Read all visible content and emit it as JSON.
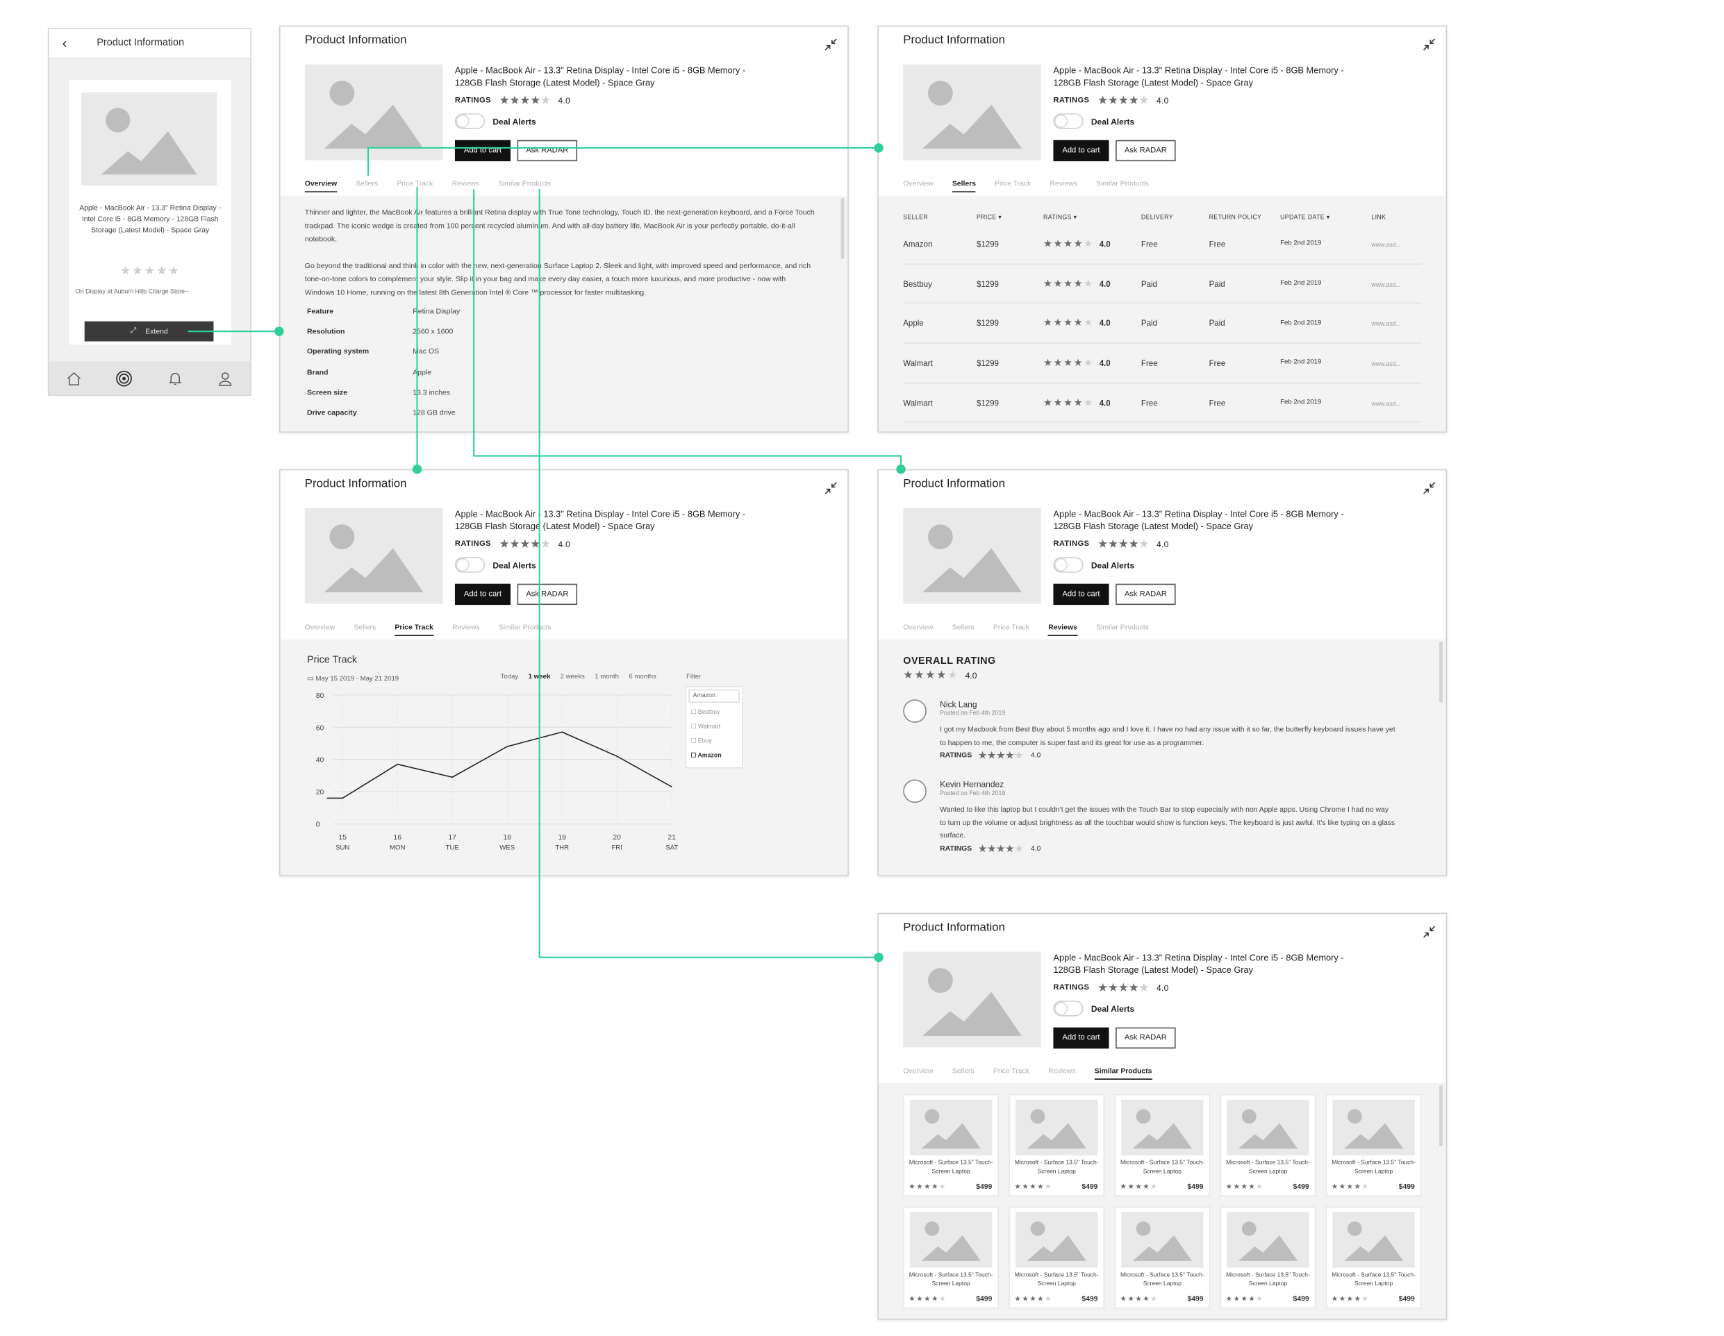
{
  "colors": {
    "connector": "#2fcf9c",
    "accent_black": "#111111",
    "placeholder_gray": "#e9e9e9",
    "content_bg": "#f3f3f3"
  },
  "icons": {
    "collapse": "collapse-arrows-icon",
    "back": "chevron-left-icon",
    "extend": "expand-arrows-icon",
    "home": "home-icon",
    "radar": "radar-icon",
    "bell": "bell-icon",
    "user": "user-icon",
    "image": "image-placeholder-icon",
    "star": "star-icon",
    "calendar": "calendar-icon",
    "checkbox": "checkbox-icon"
  },
  "product": {
    "page_title": "Product Information",
    "name": "Apple - MacBook Air - 13.3\" Retina Display - Intel Core i5 - 8GB Memory - 128GB Flash Storage (Latest Model) - Space Gray",
    "ratings_label": "RATINGS",
    "rating": "4.0",
    "rating_stars": 4,
    "deal_alerts": "Deal Alerts",
    "deal_alerts_on": false,
    "add_to_cart": "Add to cart",
    "ask_radar": "Ask RADAR"
  },
  "tabs": [
    "Overview",
    "Sellers",
    "Price Track",
    "Reviews",
    "Similar Products"
  ],
  "mobile": {
    "title": "Product Information",
    "product_name": "Apple - MacBook Air - 13.3\" Retina Display - Intel Core i5 - 8GB Memory - 128GB Flash Storage (Latest Model) - Space Gray",
    "rating_stars": 4,
    "display_note": "On Display at Auburn Hills Charge Store--",
    "extend": "Extend"
  },
  "overview": {
    "paragraph1": "Thinner and lighter, the MacBook Air features a brilliant Retina display with True Tone technology, Touch ID, the next-generation keyboard, and a Force Touch trackpad. The iconic wedge is created from 100 percent recycled aluminum. And with all-day battery life, MacBook Air is your perfectly portable, do-it-all notebook.",
    "paragraph2": "Go beyond the traditional and think in color with the new, next-generation Surface Laptop 2. Sleek and light, with improved speed and performance, and rich tone-on-tone colors to complement your style. Slip it in your bag and make every day easier, a touch more luxurious, and more productive - now with Windows 10 Home, running on the latest 8th Generation Intel ® Core ™ processor for faster multitasking.",
    "specs": [
      {
        "key": "Feature",
        "value": "Retina Display"
      },
      {
        "key": "Resolution",
        "value": "2560 x 1600"
      },
      {
        "key": "Operating system",
        "value": "Mac OS"
      },
      {
        "key": "Brand",
        "value": "Apple"
      },
      {
        "key": "Screen size",
        "value": "13.3 inches"
      },
      {
        "key": "Drive capacity",
        "value": "128 GB drive"
      }
    ]
  },
  "sellers": {
    "headers": [
      "SELLER",
      "PRICE ▾",
      "RATINGS ▾",
      "DELIVERY",
      "RETURN POLICY",
      "UPDATE DATE ▾",
      "LINK"
    ],
    "rows": [
      {
        "seller": "Amazon",
        "price": "$1299",
        "stars": 4,
        "rating": "4.0",
        "delivery": "Free",
        "return": "Free",
        "date": "Feb 2nd 2019",
        "link": "www.asd..."
      },
      {
        "seller": "Bestbuy",
        "price": "$1299",
        "stars": 4,
        "rating": "4.0",
        "delivery": "Paid",
        "return": "Paid",
        "date": "Feb 2nd 2019",
        "link": "www.asd..."
      },
      {
        "seller": "Apple",
        "price": "$1299",
        "stars": 4,
        "rating": "4.0",
        "delivery": "Paid",
        "return": "Paid",
        "date": "Feb 2nd 2019",
        "link": "www.asd..."
      },
      {
        "seller": "Walmart",
        "price": "$1299",
        "stars": 4,
        "rating": "4.0",
        "delivery": "Free",
        "return": "Free",
        "date": "Feb 2nd 2019",
        "link": "www.asd..."
      },
      {
        "seller": "Walmart",
        "price": "$1299",
        "stars": 4,
        "rating": "4.0",
        "delivery": "Free",
        "return": "Free",
        "date": "Feb 2nd 2019",
        "link": "www.asd..."
      }
    ]
  },
  "price_track": {
    "title": "Price Track",
    "date_range": "May 15 2019 - May 21 2019",
    "periods": [
      "Today",
      "1 week",
      "2 weeks",
      "1 month",
      "6 months"
    ],
    "active_period": "1 week",
    "filter_label": "Filter",
    "filter_input": "Amazon",
    "filter_options": [
      {
        "label": "Bestbuy",
        "checked": false
      },
      {
        "label": "Walmart",
        "checked": false
      },
      {
        "label": "Ebuy",
        "checked": false
      },
      {
        "label": "Amazon",
        "checked": true
      }
    ]
  },
  "chart_data": {
    "type": "line",
    "categories": [
      "15",
      "16",
      "17",
      "18",
      "19",
      "20",
      "21"
    ],
    "days": [
      "SUN",
      "MON",
      "TUE",
      "WES",
      "THR",
      "FRI",
      "SAT"
    ],
    "values": [
      16,
      37,
      29,
      48,
      57,
      42,
      23
    ],
    "ylim": [
      0,
      80
    ],
    "yticks": [
      0,
      20,
      40,
      60,
      80
    ],
    "grid": true
  },
  "reviews": {
    "overall_label": "OVERALL RATING",
    "overall_rating": "4.0",
    "overall_stars": 4,
    "items": [
      {
        "name": "Nick Lang",
        "date": "Posted on Feb 4th 2019",
        "text": "I got my Macbook from Best Buy about 5 months ago and I love it. I have no had any issue with it so far, the butterfly keyboard issues have yet to happen to me, the computer is super fast and its great for use as a programmer.",
        "ratings_label": "RATINGS",
        "rating": "4.0",
        "stars": 4
      },
      {
        "name": "Kevin Hernandez",
        "date": "Posted on Feb 4th 2019",
        "text": "Wanted to like this laptop but I couldn't get the issues with the Touch Bar to stop especially with non Apple apps. Using Chrome I had no way to turn up the volume or adjust brightness as all the touchbar would show is function keys. The keyboard is just awful. It's like typing on a glass surface.",
        "ratings_label": "RATINGS",
        "rating": "4.0",
        "stars": 4
      }
    ]
  },
  "similar": {
    "items": [
      {
        "name": "Microsoft - Surface 13.5\" Touch-Screen Laptop",
        "price": "$499",
        "stars": 4
      },
      {
        "name": "Microsoft - Surface 13.5\" Touch-Screen Laptop",
        "price": "$499",
        "stars": 4
      },
      {
        "name": "Microsoft - Surface 13.5\" Touch-Screen Laptop",
        "price": "$499",
        "stars": 4
      },
      {
        "name": "Microsoft - Surface 13.5\" Touch-Screen Laptop",
        "price": "$499",
        "stars": 4
      },
      {
        "name": "Microsoft - Surface 13.5\" Touch-Screen Laptop",
        "price": "$499",
        "stars": 4
      },
      {
        "name": "Microsoft - Surface 13.5\" Touch-Screen Laptop",
        "price": "$499",
        "stars": 4
      },
      {
        "name": "Microsoft - Surface 13.5\" Touch-Screen Laptop",
        "price": "$499",
        "stars": 4
      },
      {
        "name": "Microsoft - Surface 13.5\" Touch-Screen Laptop",
        "price": "$499",
        "stars": 4
      },
      {
        "name": "Microsoft - Surface 13.5\" Touch-Screen Laptop",
        "price": "$499",
        "stars": 4
      },
      {
        "name": "Microsoft - Surface 13.5\" Touch-Screen Laptop",
        "price": "$499",
        "stars": 4
      }
    ]
  }
}
